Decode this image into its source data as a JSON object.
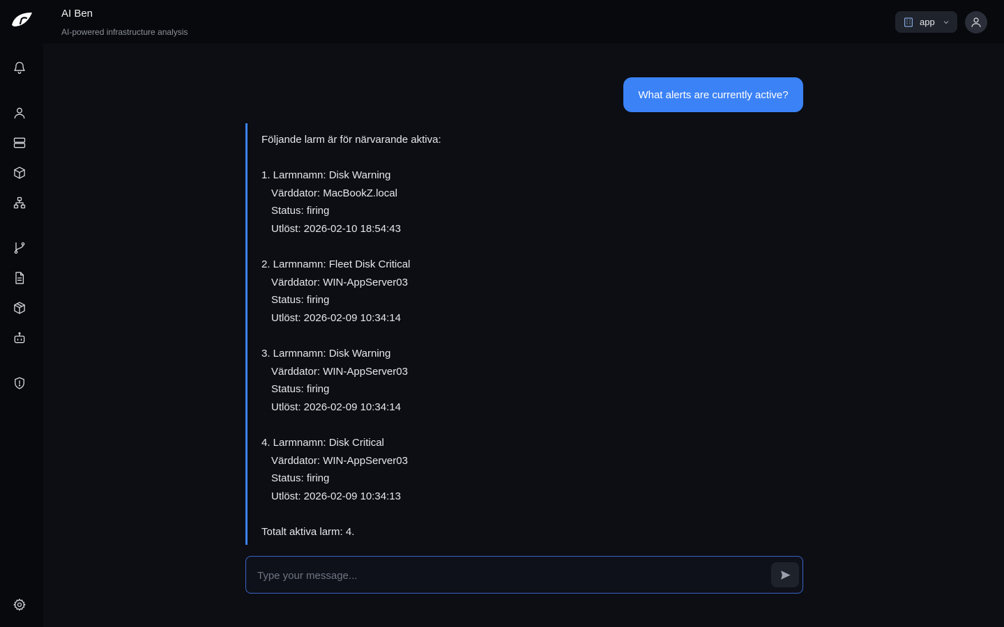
{
  "header": {
    "title": "AI Ben",
    "subtitle": "AI-powered infrastructure analysis",
    "app_selector": "app"
  },
  "sidebar": {
    "items": [
      "bell-icon",
      "user-icon",
      "server-icon",
      "package-icon",
      "network-icon",
      "git-branch-icon",
      "document-icon",
      "box-icon",
      "bot-icon",
      "shield-icon"
    ],
    "footer": "gear-icon"
  },
  "chat": {
    "user_message": "What alerts are currently active?",
    "assistant": {
      "intro": "Följande larm är för närvarande aktiva:",
      "alerts": [
        {
          "name": "1. Larmnamn: Disk Warning",
          "host": "Värddator: MacBookZ.local",
          "status": "Status: firing",
          "triggered": "Utlöst: 2026-02-10 18:54:43"
        },
        {
          "name": "2. Larmnamn: Fleet Disk Critical",
          "host": "Värddator: WIN-AppServer03",
          "status": "Status: firing",
          "triggered": "Utlöst: 2026-02-09 10:34:14"
        },
        {
          "name": "3. Larmnamn: Disk Warning",
          "host": "Värddator: WIN-AppServer03",
          "status": "Status: firing",
          "triggered": "Utlöst: 2026-02-09 10:34:14"
        },
        {
          "name": "4. Larmnamn: Disk Critical",
          "host": "Värddator: WIN-AppServer03",
          "status": "Status: firing",
          "triggered": "Utlöst: 2026-02-09 10:34:13"
        }
      ],
      "summary": "Totalt aktiva larm: 4."
    }
  },
  "input": {
    "placeholder": "Type your message...",
    "value": ""
  },
  "colors": {
    "accent": "#3b82f6",
    "background": "#0c0e13"
  }
}
